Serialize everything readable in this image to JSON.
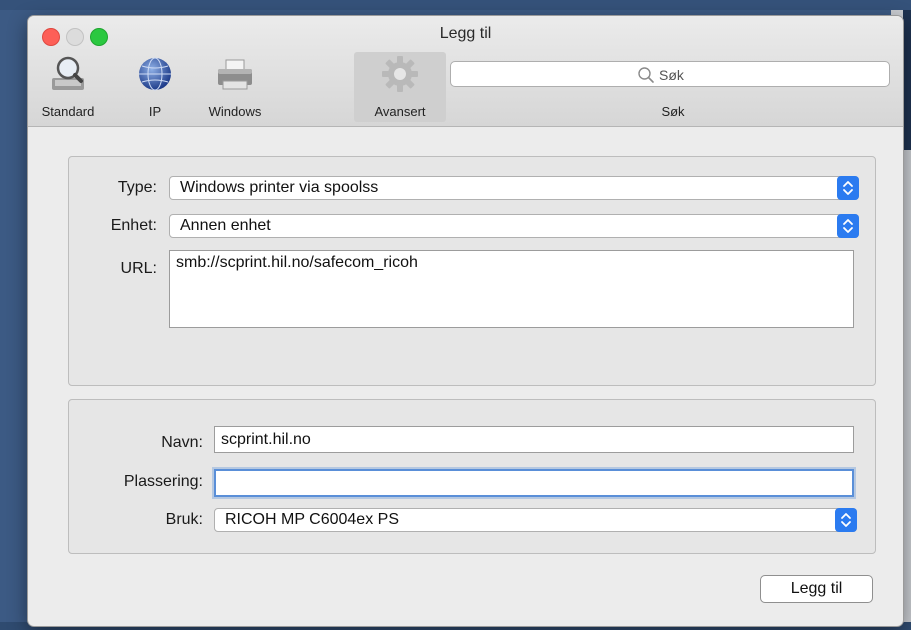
{
  "window": {
    "title": "Legg til"
  },
  "toolbar": {
    "items": [
      {
        "label": "Standard",
        "icon": "magnifier-printer-icon"
      },
      {
        "label": "IP",
        "icon": "globe-icon"
      },
      {
        "label": "Windows",
        "icon": "printer-icon"
      },
      {
        "label": "Avansert",
        "icon": "gear-icon",
        "selected": true
      }
    ],
    "search": {
      "placeholder": "Søk",
      "label": "Søk"
    }
  },
  "connection": {
    "type_label": "Type:",
    "type_value": "Windows printer via spoolss",
    "device_label": "Enhet:",
    "device_value": "Annen enhet",
    "url_label": "URL:",
    "url_value": "smb://scprint.hil.no/safecom_ricoh"
  },
  "printer": {
    "name_label": "Navn:",
    "name_value": "scprint.hil.no",
    "location_label": "Plassering:",
    "location_value": "",
    "use_label": "Bruk:",
    "use_value": "RICOH MP C6004ex PS"
  },
  "footer": {
    "add_button": "Legg til"
  },
  "colors": {
    "accent": "#2b7bf0",
    "close": "#fd5f57",
    "maximize": "#2bc840"
  }
}
